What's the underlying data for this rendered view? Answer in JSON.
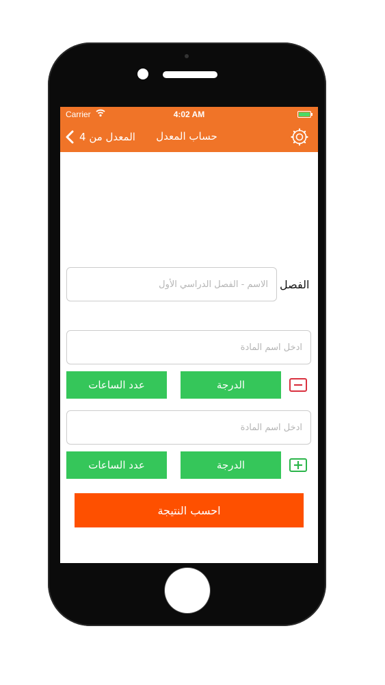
{
  "status_bar": {
    "carrier": "Carrier",
    "time": "4:02 AM"
  },
  "nav": {
    "back_label": "المعدل من 4",
    "title": "حساب المعدل"
  },
  "semester": {
    "label": "الفصل",
    "placeholder": "الاسم - الفصل الدراسي الأول"
  },
  "courses": [
    {
      "placeholder": "ادخل اسم المادة",
      "grade_label": "الدرجة",
      "hours_label": "عدد الساعات",
      "action_icon": "minus-icon"
    },
    {
      "placeholder": "ادخل اسم المادة",
      "grade_label": "الدرجة",
      "hours_label": "عدد الساعات",
      "action_icon": "plus-icon"
    }
  ],
  "calculate_label": "احسب النتيجة",
  "colors": {
    "nav": "#f07428",
    "green": "#35c65a",
    "calc": "#fe5000",
    "remove": "#d9313f",
    "add": "#2bb54a"
  }
}
